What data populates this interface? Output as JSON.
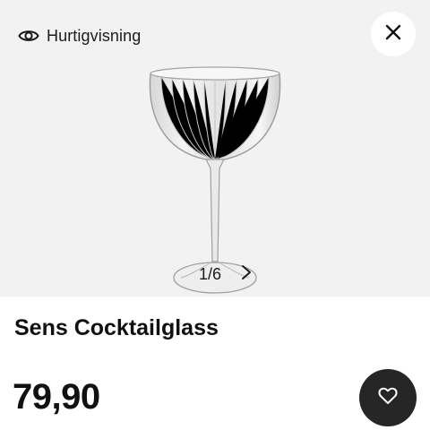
{
  "quickview": {
    "label": "Hurtigvisning",
    "icon": "eye-icon"
  },
  "close": {
    "icon": "close-icon"
  },
  "gallery": {
    "counter": "1/6",
    "next_icon": "chevron-right-icon",
    "image": "cocktail-glass"
  },
  "product": {
    "title": "Sens Cocktailglass",
    "price": "79,90"
  },
  "favorite": {
    "icon": "heart-icon"
  },
  "colors": {
    "image_bg": "#f2f2f2",
    "fav_bg": "#262626",
    "text": "#111111"
  }
}
